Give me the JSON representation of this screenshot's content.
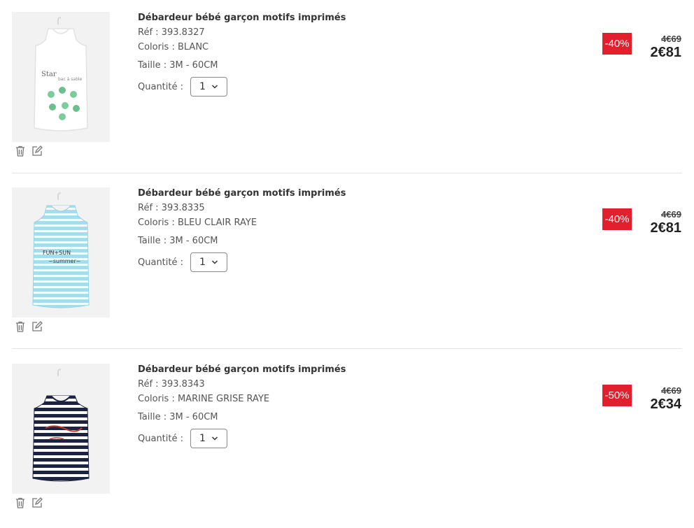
{
  "items": [
    {
      "title": "Débardeur bébé garçon motifs imprimés",
      "ref": "Réf : 393.8327",
      "color": "Coloris : BLANC",
      "size": "Taille : 3M - 60CM",
      "qty_label": "Quantité :",
      "qty_value": "1",
      "discount": "-40%",
      "old_price": "4€69",
      "new_price": "2€81"
    },
    {
      "title": "Débardeur bébé garçon motifs imprimés",
      "ref": "Réf : 393.8335",
      "color": "Coloris : BLEU CLAIR RAYE",
      "size": "Taille : 3M - 60CM",
      "qty_label": "Quantité :",
      "qty_value": "1",
      "discount": "-40%",
      "old_price": "4€69",
      "new_price": "2€81"
    },
    {
      "title": "Débardeur bébé garçon motifs imprimés",
      "ref": "Réf : 393.8343",
      "color": "Coloris : MARINE GRISE RAYE",
      "size": "Taille : 3M - 60CM",
      "qty_label": "Quantité :",
      "qty_value": "1",
      "discount": "-50%",
      "old_price": "4€69",
      "new_price": "2€34"
    }
  ],
  "images": [
    {
      "alt": "white tank top with green print"
    },
    {
      "alt": "light blue striped tank top"
    },
    {
      "alt": "navy and white striped tank top"
    }
  ],
  "colors": {
    "badge": "#e2202d",
    "text": "#333333",
    "divider": "#e3e3e3"
  },
  "icons": {
    "delete": "trash-icon",
    "edit": "edit-icon",
    "dropdown": "chevron-down-icon"
  }
}
